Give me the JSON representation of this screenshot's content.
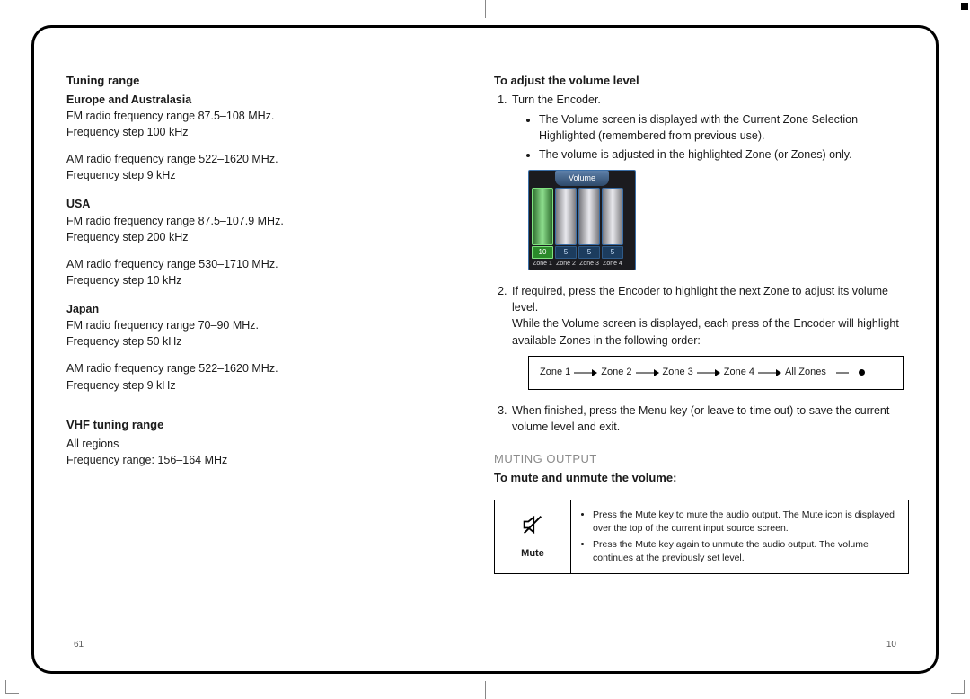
{
  "page_left_num": "61",
  "page_right_num": "10",
  "left": {
    "h1": "Tuning range",
    "regions": [
      {
        "name": "Europe and Australasia",
        "lines": [
          "FM radio frequency range 87.5–108 MHz.",
          "Frequency step 100 kHz",
          "",
          "AM radio frequency range 522–1620 MHz.",
          "Frequency step 9 kHz"
        ]
      },
      {
        "name": "USA",
        "lines": [
          "FM radio frequency range 87.5–107.9 MHz.",
          "Frequency step 200 kHz",
          "",
          "AM radio frequency range 530–1710 MHz.",
          "Frequency step 10 kHz"
        ]
      },
      {
        "name": "Japan",
        "lines": [
          "FM radio frequency range 70–90 MHz.",
          "Frequency step 50 kHz",
          "",
          "AM radio frequency range 522–1620 MHz.",
          "Frequency step 9 kHz"
        ]
      }
    ],
    "h2": "VHF tuning range",
    "vhf_lines": [
      "All regions",
      "Frequency range: 156–164 MHz"
    ]
  },
  "right": {
    "h1": "To adjust the volume level",
    "step1": "Turn the Encoder.",
    "step1_bullets": [
      "The Volume screen is displayed with the Current Zone Selection Highlighted (remembered from previous use).",
      "The volume is adjusted in the highlighted Zone (or Zones) only."
    ],
    "vol_title": "Volume",
    "vol_bars": [
      {
        "val": "10",
        "zone": "Zone 1",
        "sel": true
      },
      {
        "val": "5",
        "zone": "Zone 2",
        "sel": false
      },
      {
        "val": "5",
        "zone": "Zone 3",
        "sel": false
      },
      {
        "val": "5",
        "zone": "Zone 4",
        "sel": false
      }
    ],
    "step2": "If required, press the Encoder to highlight the next Zone to adjust its volume level.",
    "step2_extra": "While the Volume screen is displayed, each press of the Encoder will highlight available Zones in the following order:",
    "zones": [
      "Zone 1",
      "Zone 2",
      "Zone 3",
      "Zone 4",
      "All Zones"
    ],
    "step3": "When finished, press the Menu key (or leave to time out) to save the current volume level and exit.",
    "gray_h": "MUTING OUTPUT",
    "mute_h": "To mute and unmute the volume:",
    "mute_label": "Mute",
    "mute_bullets": [
      "Press the Mute key to mute the audio output. The Mute icon is displayed over the top of the current input source screen.",
      "Press the Mute key again to unmute the audio output. The volume continues at the previously set level."
    ]
  }
}
